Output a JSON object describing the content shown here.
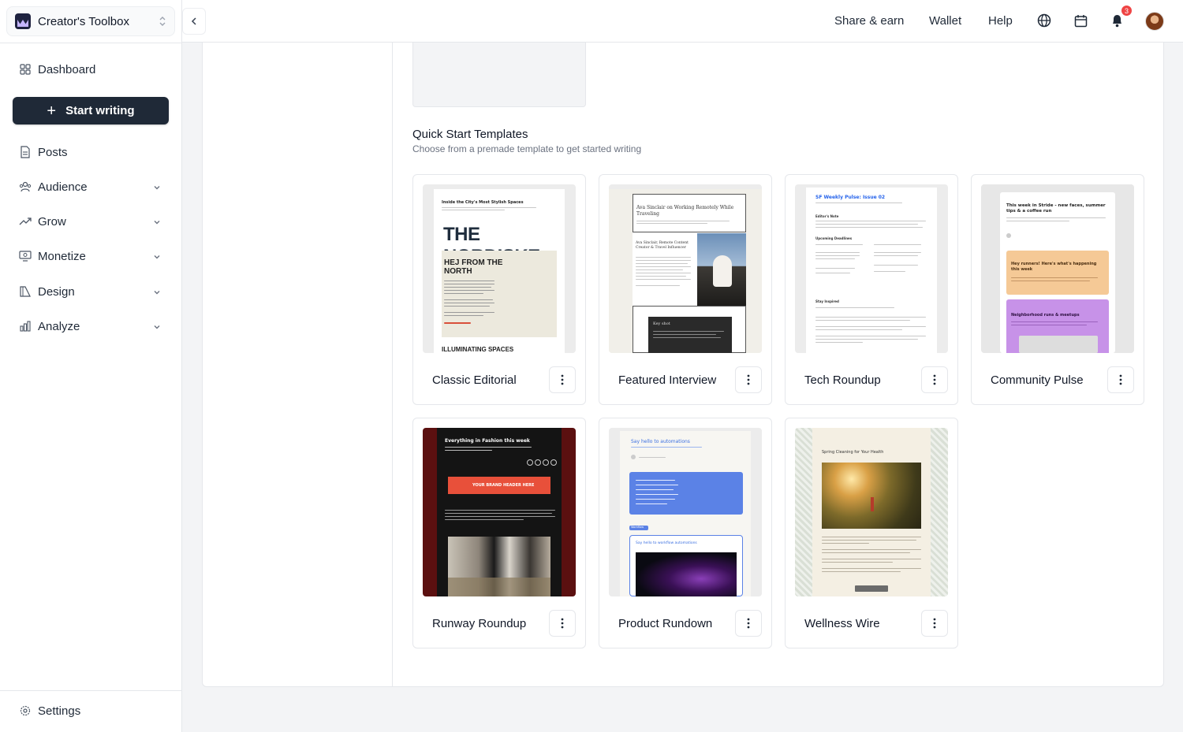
{
  "workspace": {
    "name": "Creator's Toolbox"
  },
  "sidebar": {
    "dashboard": "Dashboard",
    "start_writing": "Start writing",
    "items": [
      {
        "label": "Posts"
      },
      {
        "label": "Audience"
      },
      {
        "label": "Grow"
      },
      {
        "label": "Monetize"
      },
      {
        "label": "Design"
      },
      {
        "label": "Analyze"
      }
    ],
    "settings": "Settings"
  },
  "topbar": {
    "share_earn": "Share & earn",
    "wallet": "Wallet",
    "help": "Help",
    "notification_count": "3",
    "icons": [
      "globe-icon",
      "calendar-icon",
      "bell-icon"
    ]
  },
  "templates": {
    "title": "Quick Start Templates",
    "subtitle": "Choose from a premade template to get started writing",
    "cards": [
      {
        "name": "Classic Editorial"
      },
      {
        "name": "Featured Interview"
      },
      {
        "name": "Tech Roundup"
      },
      {
        "name": "Community Pulse"
      },
      {
        "name": "Runway Roundup"
      },
      {
        "name": "Product Rundown"
      },
      {
        "name": "Wellness Wire"
      }
    ]
  },
  "thumbs": {
    "classic": {
      "kicker": "Inside the City's Most Stylish Spaces",
      "headline": "THE NORDISKE",
      "sub1": "HEJ FROM THE",
      "sub2": "NORTH",
      "footer": "ILLUMINATING SPACES"
    },
    "interview": {
      "title": "Ava Sinclair on Working Remotely While Traveling",
      "caption": "Ava Sinclair, Remote Content Creator & Travel Influencer",
      "quote_label": "Key shot"
    },
    "tech": {
      "title": "SF Weekly Pulse: Issue 02",
      "section1": "Editor's Note",
      "section2": "Upcoming Deadlines",
      "section3": "Stay Inspired"
    },
    "community": {
      "title": "This week in Stride - new faces, summer tips & a coffee run",
      "card1": "Hey runners! Here's what's happening this week",
      "card2": "Neighborhood runs & meetups"
    },
    "runway": {
      "title": "Everything in Fashion this week",
      "cta": "YOUR BRAND HEADER HERE"
    },
    "product": {
      "title": "Say hello to automations",
      "badge": "Workflow",
      "card": "Say hello to workflow automations"
    },
    "wellness": {
      "title": "Spring Cleaning for Your Health"
    }
  },
  "colors": {
    "accent_dark": "#1f2937",
    "badge": "#ef4444",
    "brand": "#c4b5fd"
  }
}
